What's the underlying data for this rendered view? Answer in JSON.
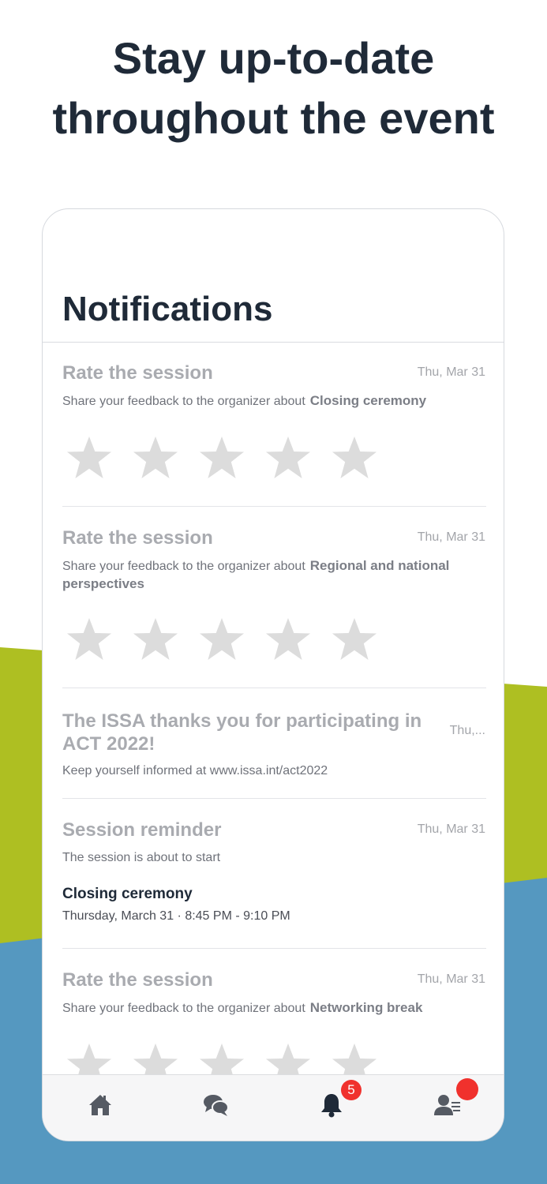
{
  "headline": {
    "line1": "Stay up-to-date",
    "line2": "throughout the event"
  },
  "colors": {
    "headline": "#1f2a38",
    "green": "#aebf22",
    "blue": "#5598c0",
    "badge": "#f0312d",
    "star": "#dcdcdc"
  },
  "screen": {
    "title": "Notifications"
  },
  "notifications": [
    {
      "title": "Rate the session",
      "date": "Thu, Mar 31",
      "body": "Share your feedback to the organizer about",
      "session": "Closing ceremony",
      "stars": 5
    },
    {
      "title": "Rate the session",
      "date": "Thu, Mar 31",
      "body": "Share your feedback to the organizer about",
      "session": "Regional and national perspectives",
      "stars": 5
    },
    {
      "title": "The ISSA thanks you for participating in ACT 2022!",
      "date": "Thu,...",
      "body": "Keep yourself informed at www.issa.int/act2022"
    },
    {
      "title": "Session reminder",
      "date": "Thu, Mar 31",
      "body": "The session is about to start",
      "session_name": "Closing ceremony",
      "session_day": "Thursday, March 31",
      "session_time": "8:45 PM - 9:10 PM"
    },
    {
      "title": "Rate the session",
      "date": "Thu, Mar 31",
      "body": "Share your feedback to the organizer about",
      "session": "Networking break",
      "stars": 5
    }
  ],
  "tabbar": {
    "items": [
      {
        "icon": "home-icon"
      },
      {
        "icon": "chat-icon"
      },
      {
        "icon": "bell-icon",
        "badge": "5"
      },
      {
        "icon": "profile-icon",
        "dot": true
      }
    ]
  }
}
